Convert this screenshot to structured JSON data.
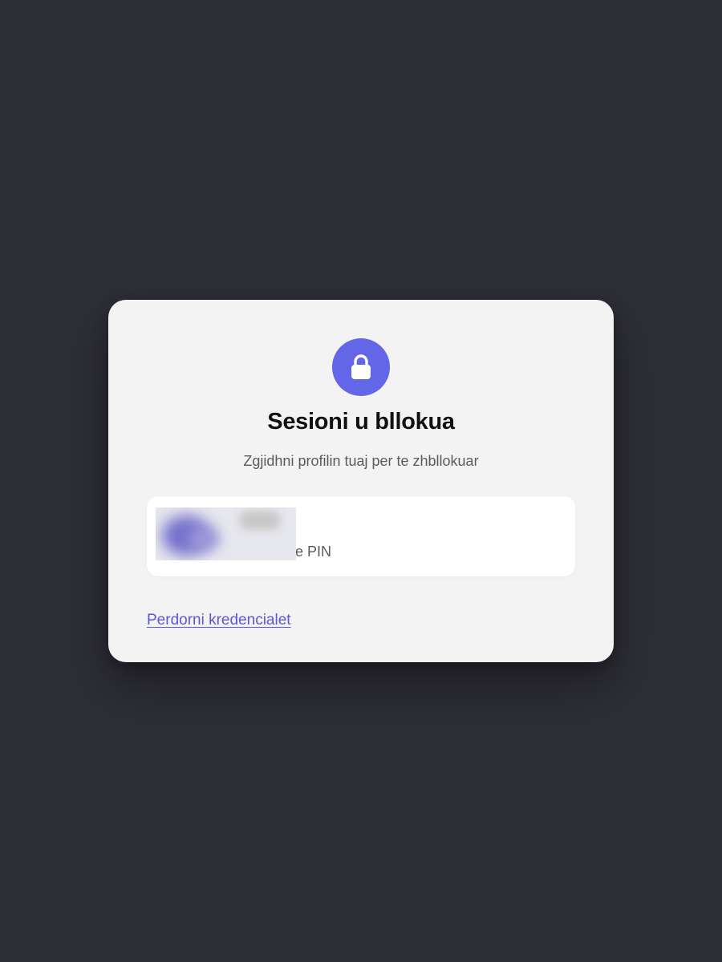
{
  "colors": {
    "backdrop": "#2e2e36",
    "card": "#f3f3f3",
    "accent": "#6366e6",
    "link": "#5b57d6"
  },
  "dialog": {
    "icon": "lock-icon",
    "title": "Sesioni u bllokua",
    "subtitle": "Zgjidhni profilin tuaj per te zhbllokuar"
  },
  "profile": {
    "method_visible": "me PIN"
  },
  "footer": {
    "credentials_link": "Perdorni kredencialet"
  }
}
